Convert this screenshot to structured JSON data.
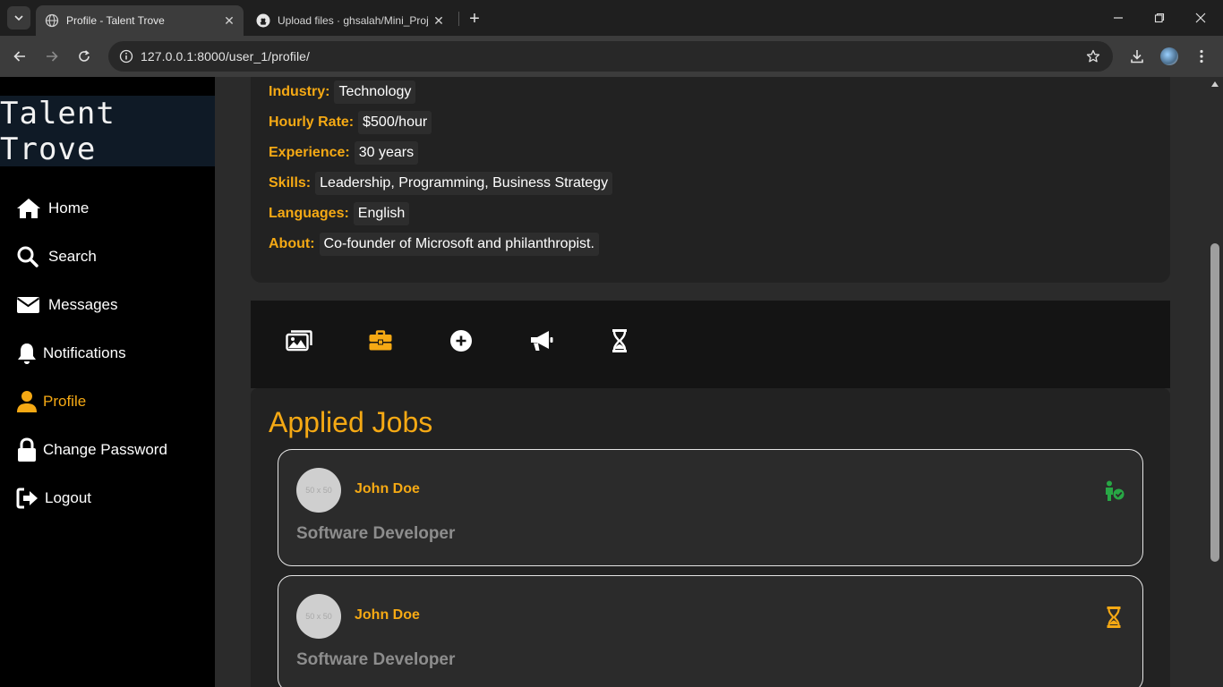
{
  "browser": {
    "tabs": [
      {
        "title": "Profile - Talent Trove",
        "favicon": "globe-icon",
        "active": true
      },
      {
        "title": "Upload files · ghsalah/Mini_Proj",
        "favicon": "github-icon",
        "active": false
      }
    ],
    "url": "127.0.0.1:8000/user_1/profile/"
  },
  "sidebar": {
    "brand": "Talent Trove",
    "items": [
      {
        "label": "Home",
        "icon": "home-icon"
      },
      {
        "label": "Search",
        "icon": "search-icon"
      },
      {
        "label": "Messages",
        "icon": "envelope-icon"
      },
      {
        "label": "Notifications",
        "icon": "bell-icon"
      },
      {
        "label": "Profile",
        "icon": "user-icon",
        "active": true
      },
      {
        "label": "Change Password",
        "icon": "lock-icon"
      },
      {
        "label": "Logout",
        "icon": "logout-icon"
      }
    ]
  },
  "profile": {
    "fields": [
      {
        "label": "Industry:",
        "value": "Technology"
      },
      {
        "label": "Hourly Rate:",
        "value": "$500/hour"
      },
      {
        "label": "Experience:",
        "value": "30 years"
      },
      {
        "label": "Skills:",
        "value": "Leadership, Programming, Business Strategy"
      },
      {
        "label": "Languages:",
        "value": "English"
      },
      {
        "label": "About:",
        "value": "Co-founder of Microsoft and philanthropist."
      }
    ]
  },
  "profile_tabs": [
    {
      "icon": "images-icon",
      "active": false
    },
    {
      "icon": "briefcase-icon",
      "active": true
    },
    {
      "icon": "plus-circle-icon",
      "active": false
    },
    {
      "icon": "megaphone-icon",
      "active": false
    },
    {
      "icon": "hourglass-icon",
      "active": false
    }
  ],
  "applied_jobs": {
    "heading": "Applied Jobs",
    "items": [
      {
        "avatar_text": "50 x 50",
        "name": "John Doe",
        "role": "Software Developer",
        "status_icon": "user-check-icon",
        "status_color": "#28a745"
      },
      {
        "avatar_text": "50 x 50",
        "name": "John Doe",
        "role": "Software Developer",
        "status_icon": "hourglass-icon",
        "status_color": "#f5a914"
      }
    ]
  },
  "colors": {
    "accent": "#f5a914",
    "success": "#28a745",
    "brand_bg": "#0f1a26"
  }
}
